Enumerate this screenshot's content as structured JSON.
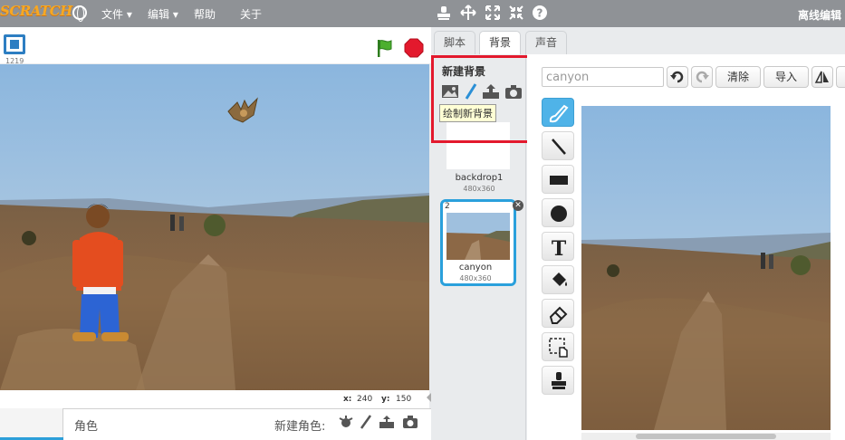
{
  "app": {
    "logo_text": "SCRATCH",
    "menu": {
      "file": "文件 ▾",
      "edit": "编辑 ▾",
      "help": "帮助",
      "about": "关于"
    },
    "offline_label": "离线编辑",
    "toolbar_icons": [
      "stamp-icon",
      "crosshair-icon",
      "grow-icon",
      "shrink-icon",
      "help-icon"
    ]
  },
  "stage": {
    "version": "1219",
    "coords": {
      "x_label": "x:",
      "x_value": "240",
      "y_label": "y:",
      "y_value": "150"
    }
  },
  "sprites": {
    "title": "角色",
    "new_label": "新建角色:"
  },
  "tabs": [
    {
      "label": "脚本",
      "active": false
    },
    {
      "label": "背景",
      "active": true
    },
    {
      "label": "声音",
      "active": false
    }
  ],
  "backdrops_panel": {
    "new_title": "新建背景",
    "tooltip": "绘制新背景",
    "items": [
      {
        "number": "",
        "name": "backdrop1",
        "size": "480x360"
      },
      {
        "number": "2",
        "name": "canyon",
        "size": "480x360",
        "selected": true
      }
    ]
  },
  "editor": {
    "name_value": "canyon",
    "clear_label": "清除",
    "import_label": "导入",
    "tools": [
      "brush-icon",
      "line-icon",
      "rectangle-icon",
      "ellipse-icon",
      "text-icon",
      "fill-icon",
      "eraser-icon",
      "select-icon",
      "stamp-icon"
    ]
  },
  "colors": {
    "menubar": "#8f9296",
    "accent": "#2aa0dc",
    "highlight_box": "#e3192d",
    "active_tool": "#4fb3e8"
  }
}
